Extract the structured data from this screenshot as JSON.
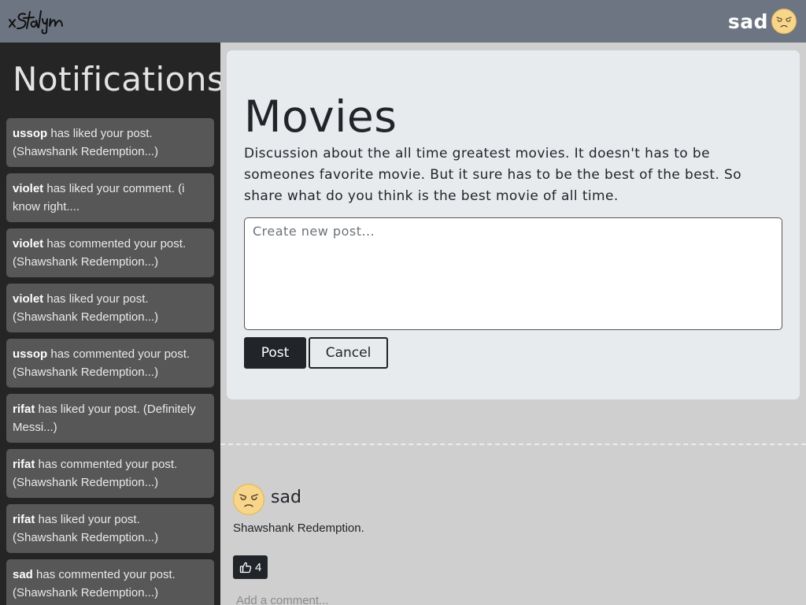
{
  "header": {
    "user_name": "sad"
  },
  "sidebar": {
    "title": "Notifications",
    "notifications": [
      {
        "user": "ussop",
        "text": " has liked your post. (Shawshank Redemption...)"
      },
      {
        "user": "violet",
        "text": " has liked your comment. (i know right...."
      },
      {
        "user": "violet",
        "text": " has commented your post. (Shawshank Redemption...)"
      },
      {
        "user": "violet",
        "text": " has liked your post. (Shawshank Redemption...)"
      },
      {
        "user": "ussop",
        "text": " has commented your post. (Shawshank Redemption...)"
      },
      {
        "user": "rifat",
        "text": " has liked your post. (Definitely Messi...)"
      },
      {
        "user": "rifat",
        "text": " has commented your post. (Shawshank Redemption...)"
      },
      {
        "user": "rifat",
        "text": " has liked your post. (Shawshank Redemption...)"
      },
      {
        "user": "sad",
        "text": " has commented your post. (Shawshank Redemption...)"
      }
    ]
  },
  "forum": {
    "title": "Movies",
    "description": "Discussion about the all time greatest movies. It doesn't has to be someones favorite movie. But it sure has to be the best of the best. So share what do you think is the best movie of all time.",
    "new_post_placeholder": "Create new post...",
    "post_button": "Post",
    "cancel_button": "Cancel"
  },
  "posts": [
    {
      "author": "sad",
      "body": "Shawshank Redemption.",
      "likes": "4",
      "comment_placeholder": "Add a comment..."
    }
  ],
  "colors": {
    "topbar": "#6c7581",
    "sidebar": "#252525",
    "notification_card": "#575757",
    "card": "#e8ebee",
    "dark_button": "#212529",
    "page_background": "#cfcfcf"
  },
  "icons": [
    "logo-signature-icon",
    "avatar-face-icon",
    "thumbs-up-icon"
  ]
}
